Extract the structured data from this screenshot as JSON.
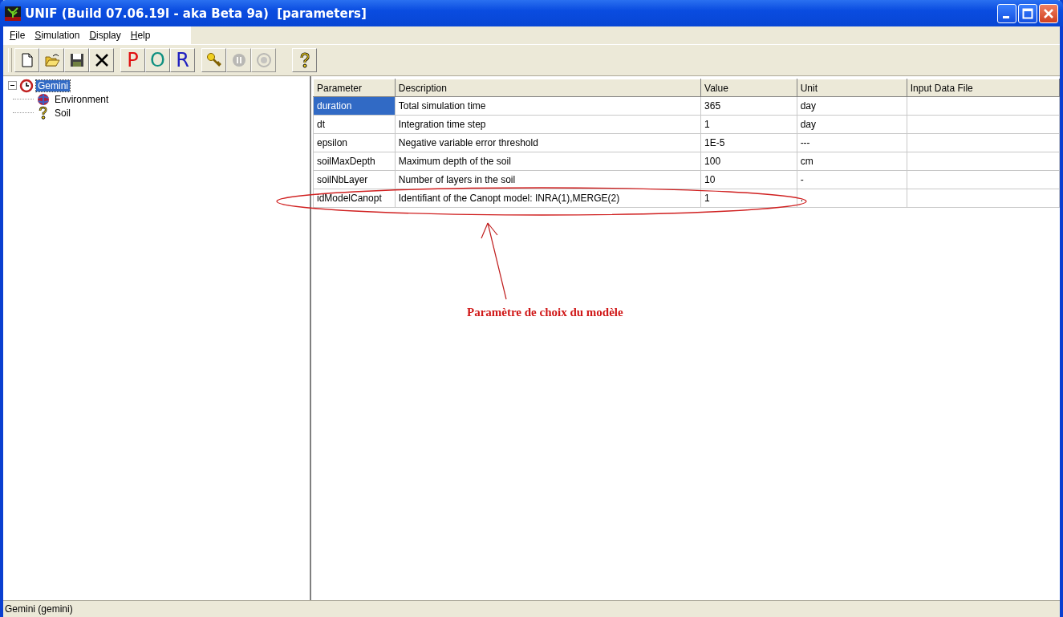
{
  "window": {
    "title": "UNIF (Build 07.06.19l - aka Beta 9a)  [parameters]"
  },
  "menu": [
    {
      "label": "File"
    },
    {
      "label": "Simulation"
    },
    {
      "label": "Display"
    },
    {
      "label": "Help"
    }
  ],
  "toolbar": [
    {
      "kind": "new",
      "disabled": false
    },
    {
      "kind": "open",
      "disabled": false
    },
    {
      "kind": "save",
      "disabled": false
    },
    {
      "kind": "delete",
      "disabled": false
    },
    {
      "kind": "letter",
      "label": "P",
      "color": "#e01010",
      "disabled": false
    },
    {
      "kind": "letter",
      "label": "O",
      "color": "#109080",
      "disabled": false
    },
    {
      "kind": "letter",
      "label": "R",
      "color": "#2020c0",
      "disabled": false
    },
    {
      "kind": "key",
      "disabled": false
    },
    {
      "kind": "pause",
      "disabled": true
    },
    {
      "kind": "stop",
      "disabled": true
    },
    {
      "kind": "help",
      "disabled": false
    }
  ],
  "tree": [
    {
      "label": "Gemini",
      "selected": true,
      "expanded": true,
      "children": [
        {
          "label": "Environment",
          "selected": false
        },
        {
          "label": "Soil",
          "selected": false
        }
      ]
    }
  ],
  "table": {
    "columns": [
      "Parameter",
      "Description",
      "Value",
      "Unit",
      "Input Data File"
    ],
    "rows": [
      {
        "parameter": "duration",
        "description": "Total simulation time",
        "value": "365",
        "unit": "day",
        "selected": true
      },
      {
        "parameter": "dt",
        "description": "Integration time step",
        "value": "1",
        "unit": "day",
        "selected": false
      },
      {
        "parameter": "epsilon",
        "description": "Negative variable error threshold",
        "value": "1E-5",
        "unit": "---",
        "selected": false
      },
      {
        "parameter": "soilMaxDepth",
        "description": "Maximum depth of the soil",
        "value": "100",
        "unit": "cm",
        "selected": false
      },
      {
        "parameter": "soilNbLayer",
        "description": "Number of layers in the soil",
        "value": "10",
        "unit": "-",
        "selected": false
      },
      {
        "parameter": "idModelCanopt",
        "description": "Identifiant of the Canopt model: INRA(1),MERGE(2)",
        "value": "1",
        "unit": ".",
        "selected": false
      }
    ]
  },
  "annotation": {
    "text": "Paramètre de choix du modèle"
  },
  "status_bar": {
    "text": "Gemini (gemini)"
  }
}
